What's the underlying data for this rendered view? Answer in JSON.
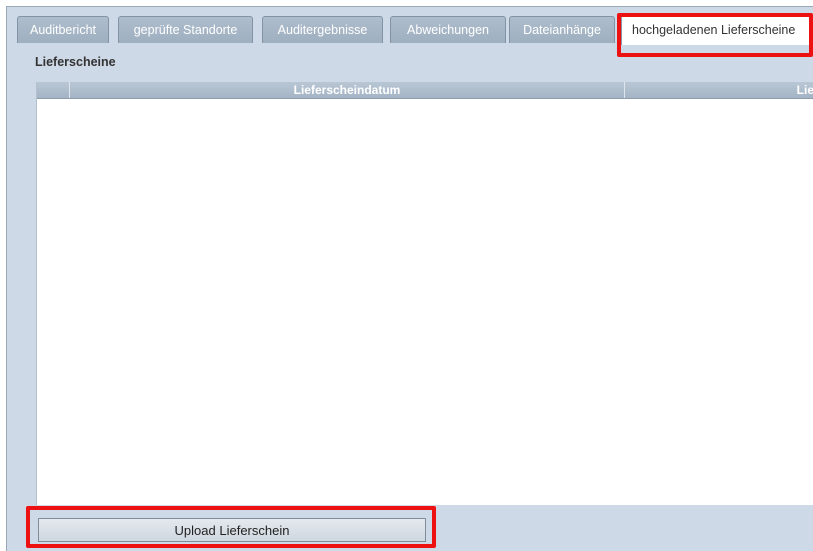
{
  "tabs": [
    {
      "label": "Auditbericht"
    },
    {
      "label": "geprüfte Standorte"
    },
    {
      "label": "Auditergebnisse"
    },
    {
      "label": "Abweichungen"
    },
    {
      "label": "Dateianhänge"
    },
    {
      "label": "hochgeladenen Lieferscheine",
      "active": true
    }
  ],
  "section": {
    "title": "Lieferscheine"
  },
  "grid": {
    "columns": [
      {
        "label": ""
      },
      {
        "label": "Lieferscheindatum"
      },
      {
        "label": "Lie"
      }
    ],
    "rows": []
  },
  "actions": {
    "upload_label": "Upload Lieferschein"
  },
  "colors": {
    "panel_background": "#cdd9e6",
    "tab_inactive": "#a7b7c8",
    "highlight": "#ee1111"
  }
}
